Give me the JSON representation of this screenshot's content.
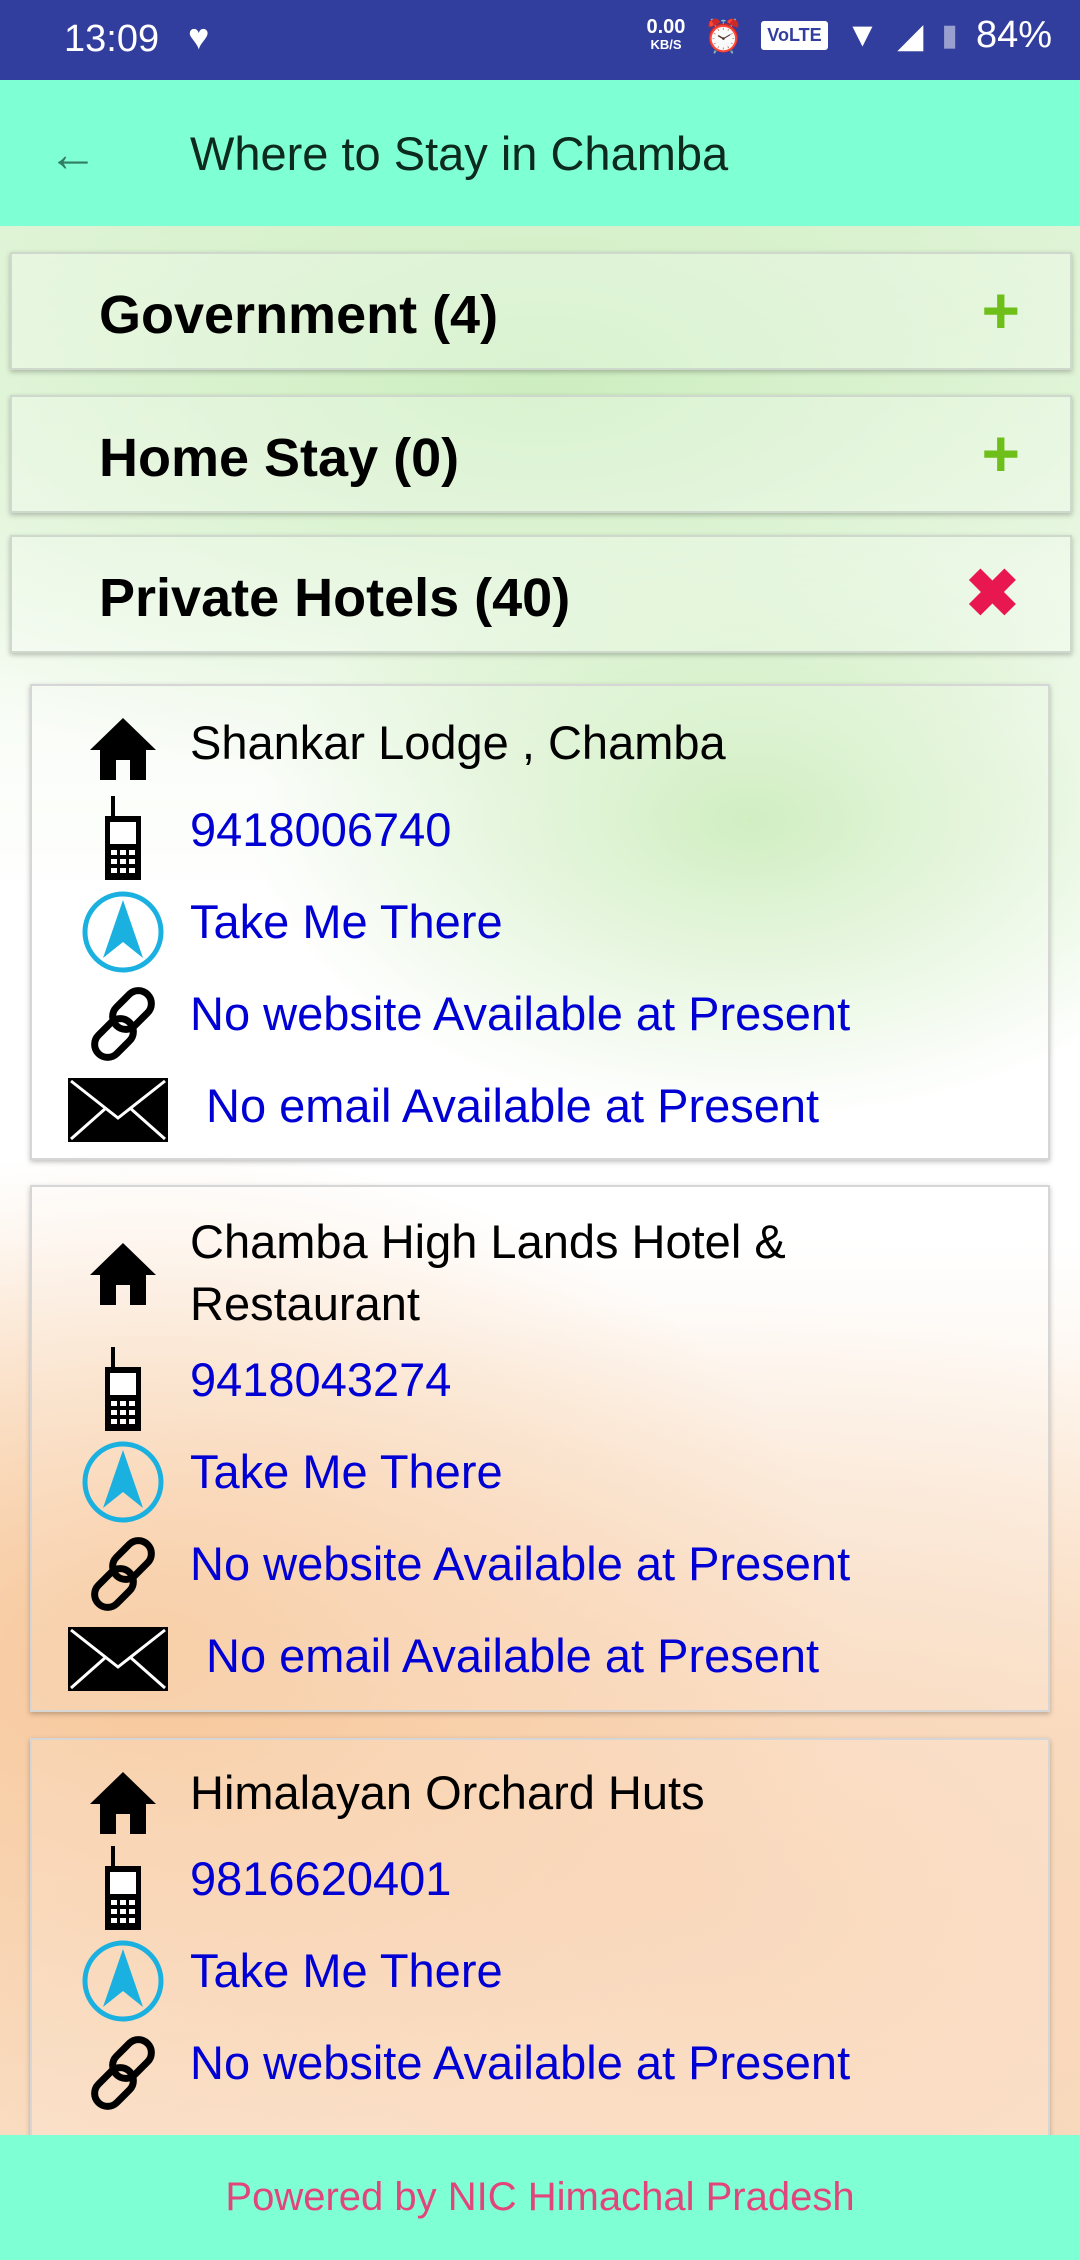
{
  "status_bar": {
    "time": "13:09",
    "net_speed": "0.00",
    "net_unit": "KB/S",
    "volte": "VoLTE",
    "battery": "84%"
  },
  "app_bar": {
    "title": "Where to Stay in Chamba"
  },
  "sections": [
    {
      "label": "Government (4)",
      "state": "collapsed"
    },
    {
      "label": "Home Stay (0)",
      "state": "collapsed"
    },
    {
      "label": "Private Hotels (40)",
      "state": "expanded"
    }
  ],
  "hotels": [
    {
      "name": "Shankar Lodge , Chamba",
      "phone": "9418006740",
      "directions": "Take Me There",
      "website": "No website Available at Present",
      "email": "No email Available at Present"
    },
    {
      "name_line1": "Chamba High Lands Hotel &",
      "name_line2": "Restaurant",
      "phone": "9418043274",
      "directions": "Take Me There",
      "website": "No website Available at Present",
      "email": "No email Available at Present"
    },
    {
      "name": "Himalayan Orchard Huts",
      "phone": "9816620401",
      "directions": "Take Me There",
      "website": "No website Available at Present"
    }
  ],
  "footer": {
    "text": "Powered by NIC Himachal Pradesh"
  },
  "colors": {
    "status_bar": "#323e9e",
    "app_bar": "#7fffd4",
    "link": "#0000d4",
    "footer_text": "#e2457c",
    "plus": "#6fbf1a",
    "close": "#e8174f"
  }
}
